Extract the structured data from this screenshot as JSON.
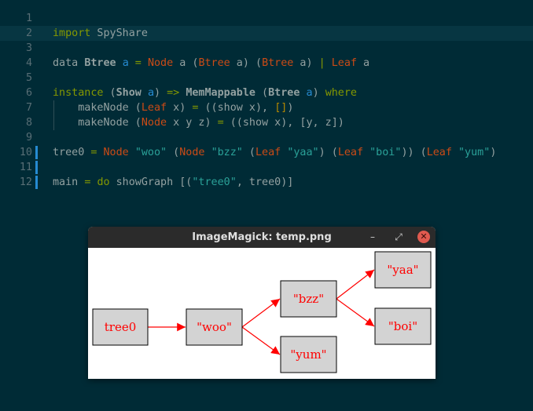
{
  "editor": {
    "line_numbers": [
      "1",
      "2",
      "3",
      "4",
      "5",
      "6",
      "7",
      "8",
      "9",
      "10",
      "11",
      "12"
    ],
    "lines": [
      [],
      [
        {
          "t": "import",
          "c": "kw"
        },
        {
          "t": " SpyShare",
          "c": "plain"
        }
      ],
      [],
      [
        {
          "t": "data ",
          "c": "plain"
        },
        {
          "t": "Btree",
          "c": "bold"
        },
        {
          "t": " ",
          "c": "plain"
        },
        {
          "t": "a",
          "c": "var"
        },
        {
          "t": " = ",
          "c": "op"
        },
        {
          "t": "Node",
          "c": "con"
        },
        {
          "t": " a (",
          "c": "plain"
        },
        {
          "t": "Btree",
          "c": "con"
        },
        {
          "t": " a) (",
          "c": "plain"
        },
        {
          "t": "Btree",
          "c": "con"
        },
        {
          "t": " a) ",
          "c": "plain"
        },
        {
          "t": "|",
          "c": "op"
        },
        {
          "t": " ",
          "c": "plain"
        },
        {
          "t": "Leaf",
          "c": "con"
        },
        {
          "t": " a",
          "c": "plain"
        }
      ],
      [],
      [
        {
          "t": "instance",
          "c": "kw"
        },
        {
          "t": " (",
          "c": "plain"
        },
        {
          "t": "Show",
          "c": "bold"
        },
        {
          "t": " ",
          "c": "plain"
        },
        {
          "t": "a",
          "c": "var"
        },
        {
          "t": ") ",
          "c": "plain"
        },
        {
          "t": "=>",
          "c": "op"
        },
        {
          "t": " ",
          "c": "plain"
        },
        {
          "t": "MemMappable",
          "c": "bold"
        },
        {
          "t": " (",
          "c": "plain"
        },
        {
          "t": "Btree",
          "c": "bold"
        },
        {
          "t": " ",
          "c": "plain"
        },
        {
          "t": "a",
          "c": "var"
        },
        {
          "t": ") ",
          "c": "plain"
        },
        {
          "t": "where",
          "c": "kw"
        }
      ],
      [
        {
          "t": "    makeNode (",
          "c": "plain"
        },
        {
          "t": "Leaf",
          "c": "con"
        },
        {
          "t": " x) ",
          "c": "plain"
        },
        {
          "t": "=",
          "c": "op"
        },
        {
          "t": " ((show x), ",
          "c": "plain"
        },
        {
          "t": "[]",
          "c": "br"
        },
        {
          "t": ")",
          "c": "plain"
        }
      ],
      [
        {
          "t": "    makeNode (",
          "c": "plain"
        },
        {
          "t": "Node",
          "c": "con"
        },
        {
          "t": " x y z) ",
          "c": "plain"
        },
        {
          "t": "=",
          "c": "op"
        },
        {
          "t": " ((show x), [y, z])",
          "c": "plain"
        }
      ],
      [],
      [
        {
          "t": "tree0 ",
          "c": "plain"
        },
        {
          "t": "=",
          "c": "op"
        },
        {
          "t": " ",
          "c": "plain"
        },
        {
          "t": "Node",
          "c": "con"
        },
        {
          "t": " ",
          "c": "plain"
        },
        {
          "t": "\"woo\"",
          "c": "str"
        },
        {
          "t": " (",
          "c": "plain"
        },
        {
          "t": "Node",
          "c": "con"
        },
        {
          "t": " ",
          "c": "plain"
        },
        {
          "t": "\"bzz\"",
          "c": "str"
        },
        {
          "t": " (",
          "c": "plain"
        },
        {
          "t": "Leaf",
          "c": "con"
        },
        {
          "t": " ",
          "c": "plain"
        },
        {
          "t": "\"yaa\"",
          "c": "str"
        },
        {
          "t": ") (",
          "c": "plain"
        },
        {
          "t": "Leaf",
          "c": "con"
        },
        {
          "t": " ",
          "c": "plain"
        },
        {
          "t": "\"boi\"",
          "c": "str"
        },
        {
          "t": ")) (",
          "c": "plain"
        },
        {
          "t": "Leaf",
          "c": "con"
        },
        {
          "t": " ",
          "c": "plain"
        },
        {
          "t": "\"yum\"",
          "c": "str"
        },
        {
          "t": ")",
          "c": "plain"
        }
      ],
      [],
      [
        {
          "t": "main ",
          "c": "plain"
        },
        {
          "t": "=",
          "c": "op"
        },
        {
          "t": " ",
          "c": "plain"
        },
        {
          "t": "do",
          "c": "kw"
        },
        {
          "t": " showGraph [(",
          "c": "plain"
        },
        {
          "t": "\"tree0\"",
          "c": "str"
        },
        {
          "t": ", tree0)]",
          "c": "plain"
        }
      ]
    ],
    "current_line": 2,
    "modified_lines": [
      10,
      11,
      12
    ]
  },
  "window": {
    "title": "ImageMagick: temp.png",
    "minimize_glyph": "–",
    "maximize_glyph": "⤢",
    "close_glyph": "✕"
  },
  "graph": {
    "nodes": [
      {
        "id": "tree0",
        "label": "tree0"
      },
      {
        "id": "woo",
        "label": "\"woo\""
      },
      {
        "id": "bzz",
        "label": "\"bzz\""
      },
      {
        "id": "yum",
        "label": "\"yum\""
      },
      {
        "id": "yaa",
        "label": "\"yaa\""
      },
      {
        "id": "boi",
        "label": "\"boi\""
      }
    ],
    "edges": [
      [
        "tree0",
        "woo"
      ],
      [
        "woo",
        "bzz"
      ],
      [
        "woo",
        "yum"
      ],
      [
        "bzz",
        "yaa"
      ],
      [
        "bzz",
        "boi"
      ]
    ],
    "colors": {
      "node_fill": "#d3d3d3",
      "label": "#ff0000",
      "edge": "#ff0000"
    }
  }
}
